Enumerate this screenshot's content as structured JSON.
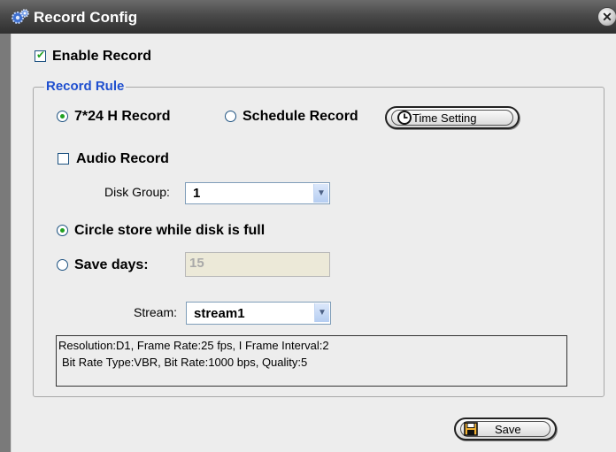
{
  "window": {
    "title": "Record Config"
  },
  "enable_record": {
    "label": "Enable Record",
    "checked": true
  },
  "record_rule": {
    "title": "Record Rule",
    "mode_724_label": "7*24 H Record",
    "mode_schedule_label": "Schedule Record",
    "time_setting_label": "Time Setting",
    "audio_record_label": "Audio Record",
    "disk_group_label": "Disk Group:",
    "disk_group_value": "1",
    "circle_store_label": "Circle store while disk is full",
    "save_days_label": "Save days:",
    "save_days_value": "15",
    "stream_label": "Stream:",
    "stream_value": "stream1",
    "info_line1": "Resolution:D1, Frame Rate:25 fps, I Frame Interval:2",
    "info_line2": "Bit Rate Type:VBR, Bit Rate:1000 bps, Quality:5"
  },
  "footer": {
    "save_label": "Save"
  },
  "colors": {
    "accent_check": "#21a121",
    "group_title": "#1f4fcf",
    "titlebar": "#3c3c3c"
  },
  "icons": [
    "gears-icon",
    "close-icon",
    "clock-icon",
    "save-icon",
    "chevron-down-icon"
  ]
}
